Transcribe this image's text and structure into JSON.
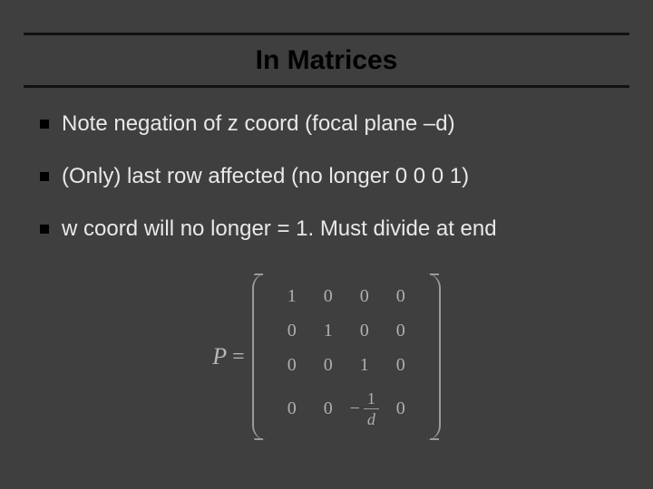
{
  "title": "In Matrices",
  "bullets": [
    "Note negation of z coord (focal plane –d)",
    "(Only) last row affected (no longer 0 0 0 1)",
    "w coord will no longer = 1.  Must divide at end"
  ],
  "equation": {
    "lhs": "P",
    "eq": "=",
    "matrix": {
      "rows": 4,
      "cols": 4,
      "r0": {
        "c0": "1",
        "c1": "0",
        "c2": "0",
        "c3": "0"
      },
      "r1": {
        "c0": "0",
        "c1": "1",
        "c2": "0",
        "c3": "0"
      },
      "r2": {
        "c0": "0",
        "c1": "0",
        "c2": "1",
        "c3": "0"
      },
      "r3": {
        "c0": "0",
        "c1": "0",
        "c2_neg": "−",
        "c2_num": "1",
        "c2_den": "d",
        "c3": "0"
      }
    }
  }
}
